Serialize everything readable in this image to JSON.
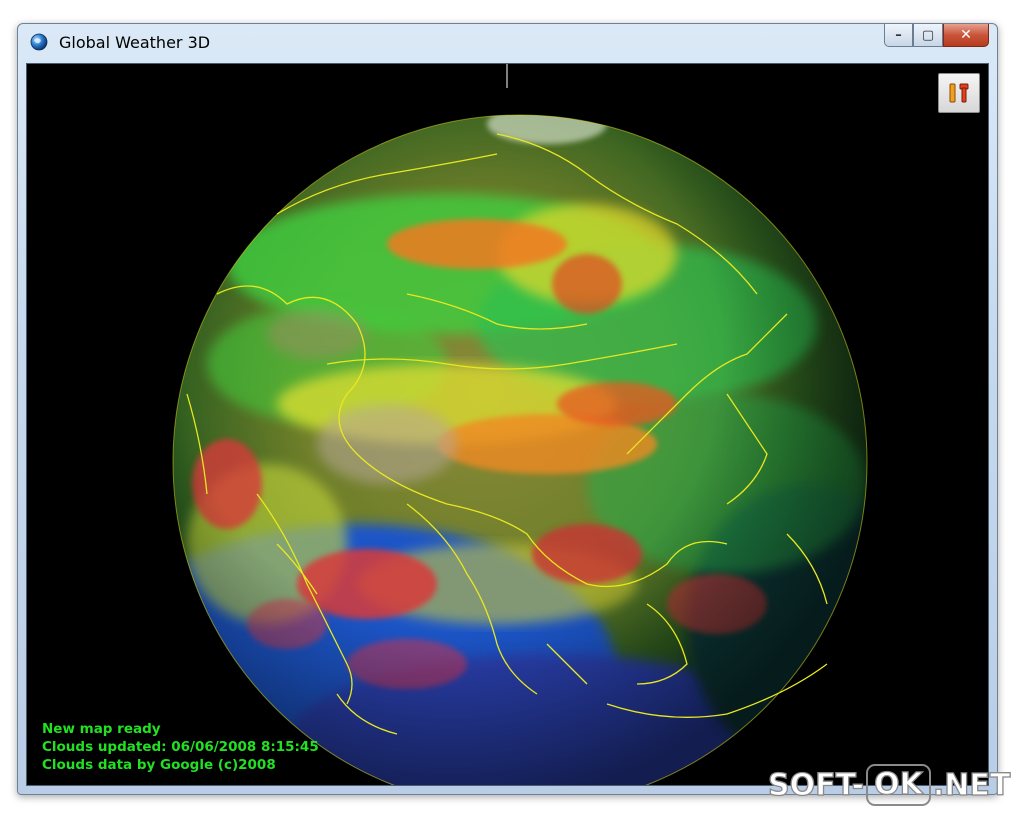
{
  "window": {
    "title": "Global Weather 3D",
    "minimize_label": "–",
    "maximize_label": "▢",
    "close_label": "✕"
  },
  "toolbar": {
    "settings_icon": "settings-tools-icon"
  },
  "status": {
    "line1": "New map ready",
    "line2": "Clouds updated: 06/06/2008 8:15:45",
    "line3": "Clouds data by Google (c)2008"
  },
  "watermark": {
    "part1": "SOFT-",
    "part2": "OK",
    "part3": ".NET"
  },
  "colors": {
    "status_text": "#22e022",
    "viewport_bg": "#000000",
    "border_lines": "#e6e600"
  }
}
